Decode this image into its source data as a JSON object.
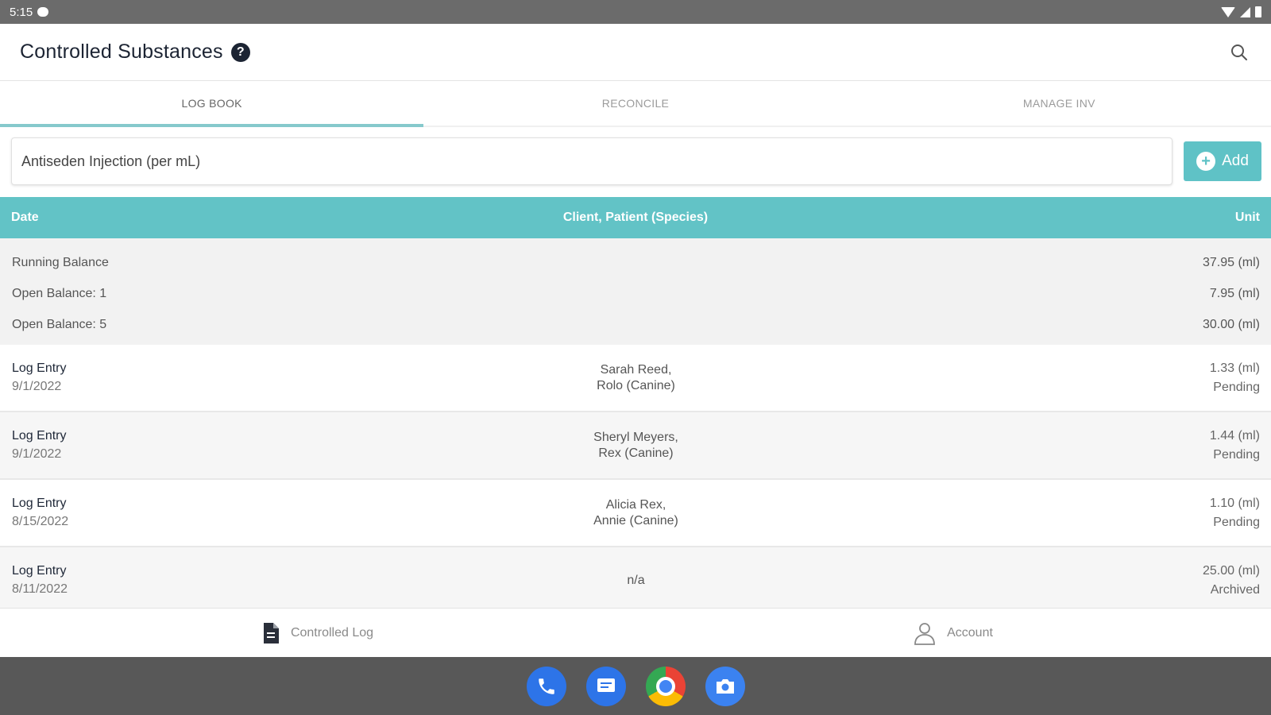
{
  "status_bar": {
    "time": "5:15"
  },
  "app_bar": {
    "title": "Controlled Substances",
    "help_glyph": "?"
  },
  "tabs": [
    {
      "label": "LOG BOOK",
      "active": true
    },
    {
      "label": "RECONCILE",
      "active": false
    },
    {
      "label": "MANAGE INV",
      "active": false
    }
  ],
  "filter": {
    "drug_value": "Antiseden Injection (per mL)",
    "add_label": "Add"
  },
  "table": {
    "headers": {
      "date": "Date",
      "client": "Client, Patient (Species)",
      "unit": "Unit"
    },
    "balances": [
      {
        "label": "Running Balance",
        "value": "37.95 (ml)"
      },
      {
        "label": "Open Balance: 1",
        "value": "7.95 (ml)"
      },
      {
        "label": "Open Balance: 5",
        "value": "30.00 (ml)"
      }
    ],
    "entries": [
      {
        "type": "Log Entry",
        "date": "9/1/2022",
        "client": "Sarah Reed,",
        "patient": "Rolo (Canine)",
        "amount": "1.33 (ml)",
        "status": "Pending"
      },
      {
        "type": "Log Entry",
        "date": "9/1/2022",
        "client": "Sheryl Meyers,",
        "patient": "Rex (Canine)",
        "amount": "1.44 (ml)",
        "status": "Pending"
      },
      {
        "type": "Log Entry",
        "date": "8/15/2022",
        "client": "Alicia Rex,",
        "patient": "Annie (Canine)",
        "amount": "1.10 (ml)",
        "status": "Pending"
      },
      {
        "type": "Log Entry",
        "date": "8/11/2022",
        "client": "n/a",
        "patient": "",
        "amount": "25.00 (ml)",
        "status": "Archived"
      }
    ]
  },
  "bottom_nav": {
    "controlled_log_label": "Controlled Log",
    "account_label": "Account"
  },
  "colors": {
    "accent": "#62c3c6",
    "title": "#1c2433",
    "status_bar": "#6b6b6b",
    "system_bar": "#585858"
  },
  "icons": [
    "help-icon",
    "search-icon",
    "add-circle-icon",
    "document-icon",
    "person-icon",
    "phone-icon",
    "messages-icon",
    "chrome-icon",
    "camera-icon"
  ]
}
